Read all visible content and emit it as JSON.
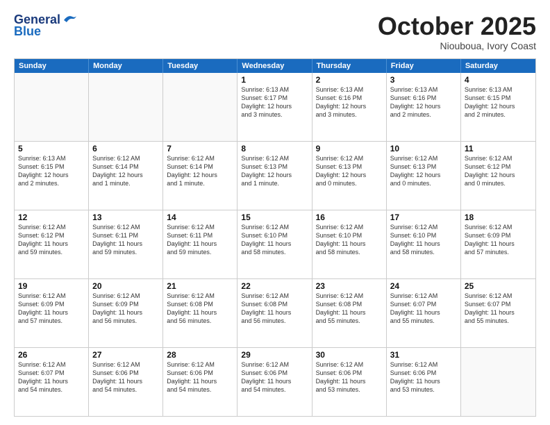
{
  "header": {
    "logo_line1": "General",
    "logo_line2": "Blue",
    "month": "October 2025",
    "location": "Niouboua, Ivory Coast"
  },
  "day_headers": [
    "Sunday",
    "Monday",
    "Tuesday",
    "Wednesday",
    "Thursday",
    "Friday",
    "Saturday"
  ],
  "weeks": [
    [
      {
        "day": "",
        "info": ""
      },
      {
        "day": "",
        "info": ""
      },
      {
        "day": "",
        "info": ""
      },
      {
        "day": "1",
        "info": "Sunrise: 6:13 AM\nSunset: 6:17 PM\nDaylight: 12 hours\nand 3 minutes."
      },
      {
        "day": "2",
        "info": "Sunrise: 6:13 AM\nSunset: 6:16 PM\nDaylight: 12 hours\nand 3 minutes."
      },
      {
        "day": "3",
        "info": "Sunrise: 6:13 AM\nSunset: 6:16 PM\nDaylight: 12 hours\nand 2 minutes."
      },
      {
        "day": "4",
        "info": "Sunrise: 6:13 AM\nSunset: 6:15 PM\nDaylight: 12 hours\nand 2 minutes."
      }
    ],
    [
      {
        "day": "5",
        "info": "Sunrise: 6:13 AM\nSunset: 6:15 PM\nDaylight: 12 hours\nand 2 minutes."
      },
      {
        "day": "6",
        "info": "Sunrise: 6:12 AM\nSunset: 6:14 PM\nDaylight: 12 hours\nand 1 minute."
      },
      {
        "day": "7",
        "info": "Sunrise: 6:12 AM\nSunset: 6:14 PM\nDaylight: 12 hours\nand 1 minute."
      },
      {
        "day": "8",
        "info": "Sunrise: 6:12 AM\nSunset: 6:13 PM\nDaylight: 12 hours\nand 1 minute."
      },
      {
        "day": "9",
        "info": "Sunrise: 6:12 AM\nSunset: 6:13 PM\nDaylight: 12 hours\nand 0 minutes."
      },
      {
        "day": "10",
        "info": "Sunrise: 6:12 AM\nSunset: 6:13 PM\nDaylight: 12 hours\nand 0 minutes."
      },
      {
        "day": "11",
        "info": "Sunrise: 6:12 AM\nSunset: 6:12 PM\nDaylight: 12 hours\nand 0 minutes."
      }
    ],
    [
      {
        "day": "12",
        "info": "Sunrise: 6:12 AM\nSunset: 6:12 PM\nDaylight: 11 hours\nand 59 minutes."
      },
      {
        "day": "13",
        "info": "Sunrise: 6:12 AM\nSunset: 6:11 PM\nDaylight: 11 hours\nand 59 minutes."
      },
      {
        "day": "14",
        "info": "Sunrise: 6:12 AM\nSunset: 6:11 PM\nDaylight: 11 hours\nand 59 minutes."
      },
      {
        "day": "15",
        "info": "Sunrise: 6:12 AM\nSunset: 6:10 PM\nDaylight: 11 hours\nand 58 minutes."
      },
      {
        "day": "16",
        "info": "Sunrise: 6:12 AM\nSunset: 6:10 PM\nDaylight: 11 hours\nand 58 minutes."
      },
      {
        "day": "17",
        "info": "Sunrise: 6:12 AM\nSunset: 6:10 PM\nDaylight: 11 hours\nand 58 minutes."
      },
      {
        "day": "18",
        "info": "Sunrise: 6:12 AM\nSunset: 6:09 PM\nDaylight: 11 hours\nand 57 minutes."
      }
    ],
    [
      {
        "day": "19",
        "info": "Sunrise: 6:12 AM\nSunset: 6:09 PM\nDaylight: 11 hours\nand 57 minutes."
      },
      {
        "day": "20",
        "info": "Sunrise: 6:12 AM\nSunset: 6:09 PM\nDaylight: 11 hours\nand 56 minutes."
      },
      {
        "day": "21",
        "info": "Sunrise: 6:12 AM\nSunset: 6:08 PM\nDaylight: 11 hours\nand 56 minutes."
      },
      {
        "day": "22",
        "info": "Sunrise: 6:12 AM\nSunset: 6:08 PM\nDaylight: 11 hours\nand 56 minutes."
      },
      {
        "day": "23",
        "info": "Sunrise: 6:12 AM\nSunset: 6:08 PM\nDaylight: 11 hours\nand 55 minutes."
      },
      {
        "day": "24",
        "info": "Sunrise: 6:12 AM\nSunset: 6:07 PM\nDaylight: 11 hours\nand 55 minutes."
      },
      {
        "day": "25",
        "info": "Sunrise: 6:12 AM\nSunset: 6:07 PM\nDaylight: 11 hours\nand 55 minutes."
      }
    ],
    [
      {
        "day": "26",
        "info": "Sunrise: 6:12 AM\nSunset: 6:07 PM\nDaylight: 11 hours\nand 54 minutes."
      },
      {
        "day": "27",
        "info": "Sunrise: 6:12 AM\nSunset: 6:06 PM\nDaylight: 11 hours\nand 54 minutes."
      },
      {
        "day": "28",
        "info": "Sunrise: 6:12 AM\nSunset: 6:06 PM\nDaylight: 11 hours\nand 54 minutes."
      },
      {
        "day": "29",
        "info": "Sunrise: 6:12 AM\nSunset: 6:06 PM\nDaylight: 11 hours\nand 54 minutes."
      },
      {
        "day": "30",
        "info": "Sunrise: 6:12 AM\nSunset: 6:06 PM\nDaylight: 11 hours\nand 53 minutes."
      },
      {
        "day": "31",
        "info": "Sunrise: 6:12 AM\nSunset: 6:06 PM\nDaylight: 11 hours\nand 53 minutes."
      },
      {
        "day": "",
        "info": ""
      }
    ]
  ]
}
